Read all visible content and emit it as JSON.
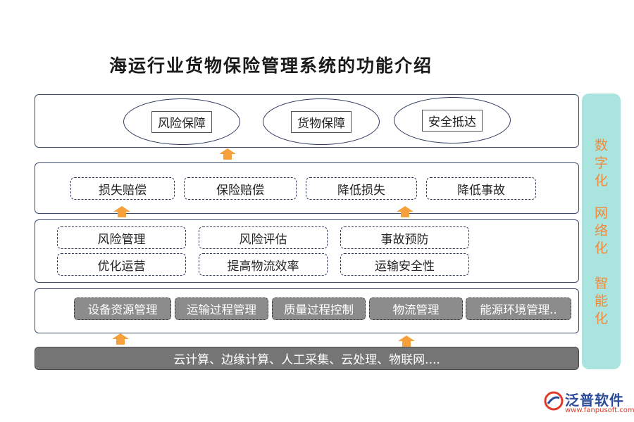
{
  "title": "海运行业货物保险管理系统的功能介绍",
  "layer1": [
    "风险保障",
    "货物保障",
    "安全抵达"
  ],
  "layer2": [
    "损失赔偿",
    "保险赔偿",
    "降低损失",
    "降低事故"
  ],
  "layer3": [
    "风险管理",
    "风险评估",
    "事故预防",
    "优化运营",
    "提高物流效率",
    "运输安全性"
  ],
  "layer4": [
    "设备资源管理",
    "运输过程管理",
    "质量过程控制",
    "物流管理",
    "能源环境管理.."
  ],
  "base": "云计算、边缘计算、人工采集、云处理、物联网....",
  "side": [
    "数",
    "字",
    "化",
    "网",
    "络",
    "化",
    "智",
    "能",
    "化"
  ],
  "logo": {
    "name": "泛普软件",
    "url": "www.fanpusoft.com"
  },
  "colors": {
    "arrow": "#f5a03a",
    "side_bg": "#a9e5de",
    "side_text": "#f08a3c",
    "border": "#3f4a6b"
  }
}
